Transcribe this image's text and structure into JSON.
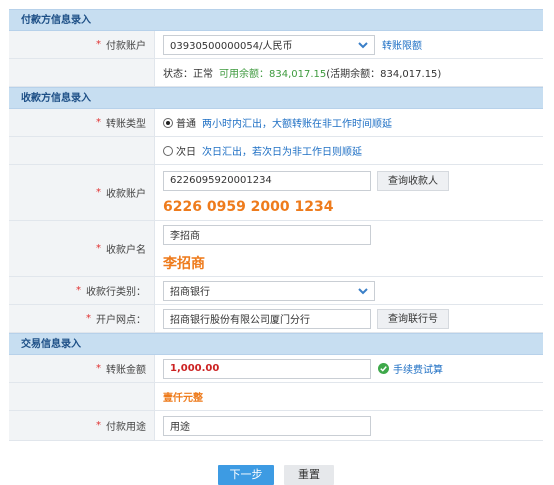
{
  "payer_section": {
    "title": "付款方信息录入",
    "account_label": "付款账户",
    "account_value": "03930500000054/人民币",
    "account_link": "转账限额",
    "status_prefix": "状态：正常",
    "available": "可用余额：834,017.15",
    "current": "(活期余额：834,017.15)"
  },
  "payee_section": {
    "title": "收款方信息录入",
    "transfer_type_label": "转账类型",
    "option_normal": "普通",
    "option_normal_note": "两小时内汇出，大额转账在非工作时间顺延",
    "option_nextday": "次日",
    "option_nextday_note": "次日汇出，若次日为非工作日则顺延",
    "account_label": "收款账户",
    "account_value": "6226095920001234",
    "query_payee": "查询收款人",
    "account_big": "6226 0959 2000 1234",
    "name_label": "收款户名",
    "name_value": "李招商",
    "name_big": "李招商",
    "bank_type_label": "收款行类别：",
    "bank_type_value": "招商银行",
    "branch_label": "开户网点：",
    "branch_value": "招商银行股份有限公司厦门分行",
    "query_branch": "查询联行号"
  },
  "trade_section": {
    "title": "交易信息录入",
    "amount_label": "转账金额",
    "amount_value": "1,000.00",
    "fee_link": "手续费试算",
    "amount_cn": "壹仟元整",
    "purpose_label": "付款用途",
    "purpose_placeholder": "用途"
  },
  "footer": {
    "next": "下一步",
    "reset": "重置"
  },
  "required_mark": "*",
  "colors": {
    "accent": "#3d9be3",
    "section": "#c7def1",
    "orange": "#ee7b1c",
    "green": "#3e9a3e",
    "red": "#cc2222"
  }
}
